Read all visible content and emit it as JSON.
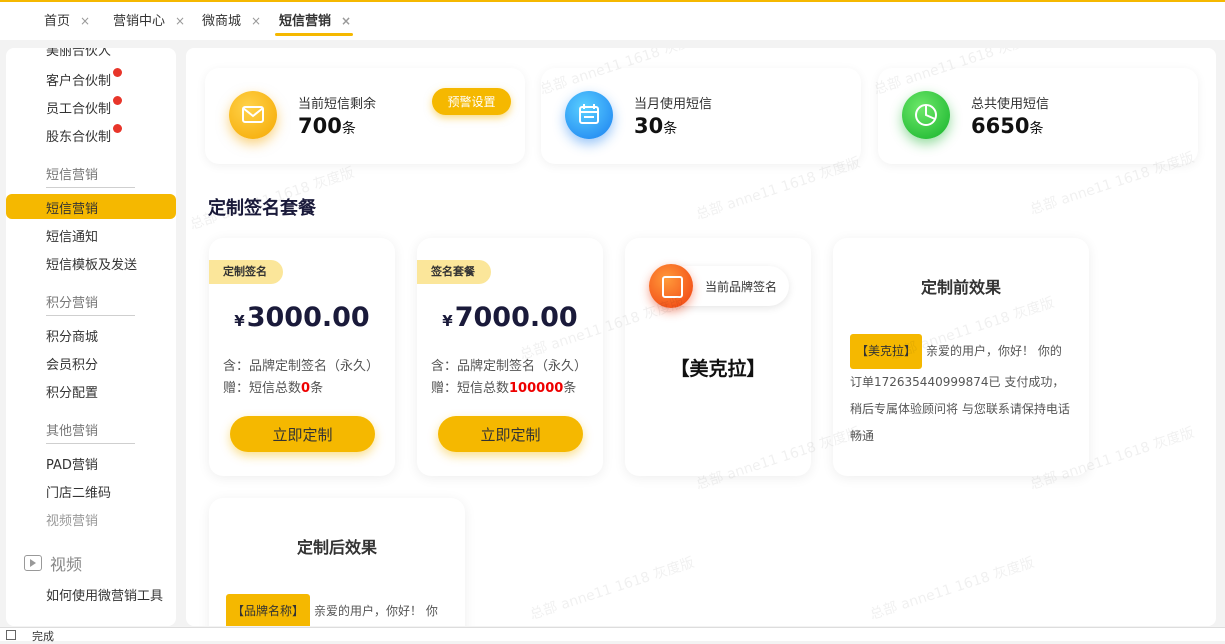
{
  "tabs": [
    {
      "label": "首页"
    },
    {
      "label": "营销中心"
    },
    {
      "label": "微商城"
    },
    {
      "label": "短信营销",
      "active": true
    }
  ],
  "tab_close": "×",
  "sidebar": {
    "items_top": [
      "美丽合伙人",
      "客户合伙制",
      "员工合伙制",
      "股东合伙制"
    ],
    "group_sms": "短信营销",
    "sms_items": [
      "短信营销",
      "短信通知",
      "短信模板及发送"
    ],
    "group_points": "积分营销",
    "points_items": [
      "积分商城",
      "会员积分",
      "积分配置"
    ],
    "group_other": "其他营销",
    "other_items": [
      "PAD营销",
      "门店二维码",
      "视频营销"
    ],
    "video_group": "视频",
    "video_items": [
      "如何使用微营销工具"
    ]
  },
  "stats": [
    {
      "label": "当前短信剩余",
      "value": "700",
      "unit": "条",
      "icon": "envelope-icon",
      "color": "#f5b800"
    },
    {
      "label": "当月使用短信",
      "value": "30",
      "unit": "条",
      "icon": "calendar-icon",
      "color": "#1e90ff"
    },
    {
      "label": "总共使用短信",
      "value": "6650",
      "unit": "条",
      "icon": "pie-chart-icon",
      "color": "#22c33a"
    }
  ],
  "warn_button": "预警设置",
  "section_title": "定制签名套餐",
  "packages": [
    {
      "tag": "定制签名",
      "currency": "¥",
      "price": "3000.00",
      "line1": "含：品牌定制签名（永久）",
      "line2_prefix": "赠：短信总数",
      "line2_count": "0",
      "line2_suffix": "条",
      "button": "立即定制"
    },
    {
      "tag": "签名套餐",
      "currency": "¥",
      "price": "7000.00",
      "line1": "含：品牌定制签名（永久）",
      "line2_prefix": "赠：短信总数",
      "line2_count": "100000",
      "line2_suffix": "条",
      "button": "立即定制"
    }
  ],
  "brand": {
    "label": "当前品牌签名",
    "name": "【美克拉】"
  },
  "before": {
    "title": "定制前效果",
    "tag": "【美克拉】",
    "text": "亲爱的用户，你好！ 你的订单172635440999874已 支付成功，稍后专属体验顾问将 与您联系请保持电话畅通"
  },
  "after": {
    "title": "定制后效果",
    "tag": "【品牌名称】",
    "text": "亲爱的用户，你好！ 你"
  },
  "watermark": "总部 anne11 1618 灰度版",
  "status": "完成",
  "colors": {
    "accent": "#f5b800",
    "tag_bg": "#fbe69a",
    "highlight": "#e00000"
  }
}
